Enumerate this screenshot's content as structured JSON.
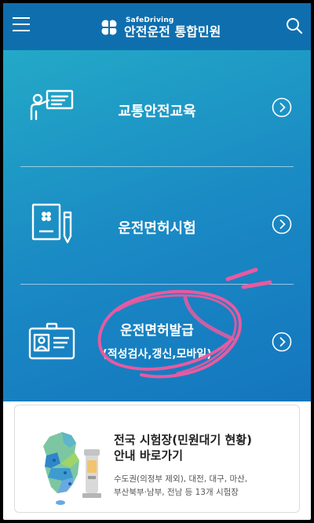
{
  "header": {
    "logo_sub": "SafeDriving",
    "logo_main": "안전운전 통합민원"
  },
  "menu": {
    "items": [
      {
        "label": "교통안전교육"
      },
      {
        "label": "운전면허시험"
      },
      {
        "label": "운전면허발급",
        "sublabel": "(적성검사,갱신,모바일)"
      }
    ]
  },
  "card": {
    "title_line1": "전국 시험장(민원대기 현황)",
    "title_line2": "안내 바로가기",
    "desc_line1": "수도권(의정부 제외), 대전, 대구, 마산,",
    "desc_line2": "부산북부·남부, 전남 등 13개 시험장"
  },
  "colors": {
    "header_bg": "#0f6fae",
    "menu_gradient_start": "#23a9c7",
    "menu_gradient_end": "#1476be",
    "annotation_pink": "#e85aa0"
  }
}
